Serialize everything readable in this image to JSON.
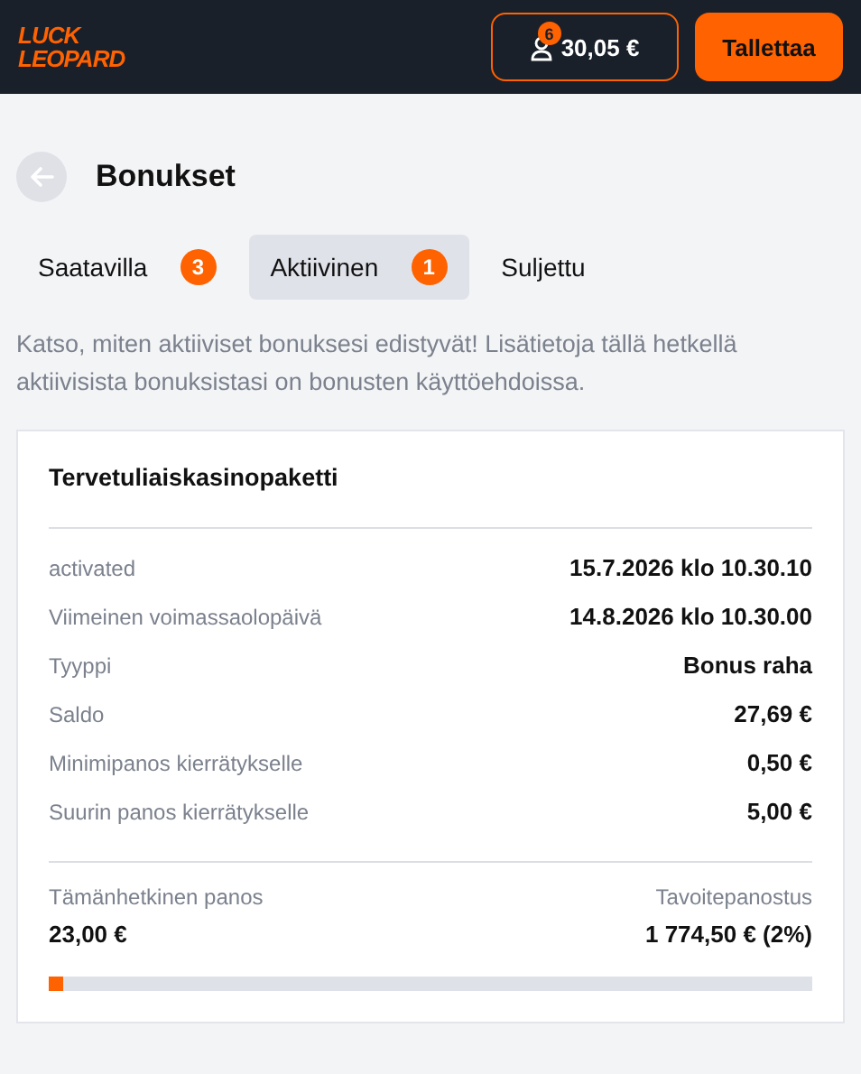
{
  "header": {
    "logo": [
      "LUCK",
      "LEOPARD"
    ],
    "notification_count": "6",
    "balance": "30,05 €",
    "deposit_button": "Tallettaa"
  },
  "page_title": "Bonukset",
  "tabs": [
    {
      "label": "Saatavilla",
      "count": "3",
      "selected": false
    },
    {
      "label": "Aktiivinen",
      "count": "1",
      "selected": true
    },
    {
      "label": "Suljettu",
      "selected": false
    }
  ],
  "description": "Katso, miten aktiiviset bonuksesi edistyvät! Lisätietoja tällä hetkellä aktiivisista bonuksistasi on bonusten käyttöehdoissa.",
  "bonus": {
    "title": "Tervetuliaiskasinopaketti",
    "details": [
      {
        "label": "activated",
        "value": "15.7.2026 klo 10.30.10"
      },
      {
        "label": "Viimeinen voimassaolopäivä",
        "value": "14.8.2026 klo 10.30.00"
      },
      {
        "label": "Tyyppi",
        "value": "Bonus raha"
      },
      {
        "label": "Saldo",
        "value": "27,69 €"
      },
      {
        "label": "Minimipanos kierrätykselle",
        "value": "0,50 €"
      },
      {
        "label": "Suurin panos kierrätykselle",
        "value": "5,00 €"
      }
    ],
    "current_label": "Tämänhetkinen panos",
    "current_value": "23,00 €",
    "target_label": "Tavoitepanostus",
    "target_value": "1 774,50 € (2%)",
    "level": 0.02
  }
}
